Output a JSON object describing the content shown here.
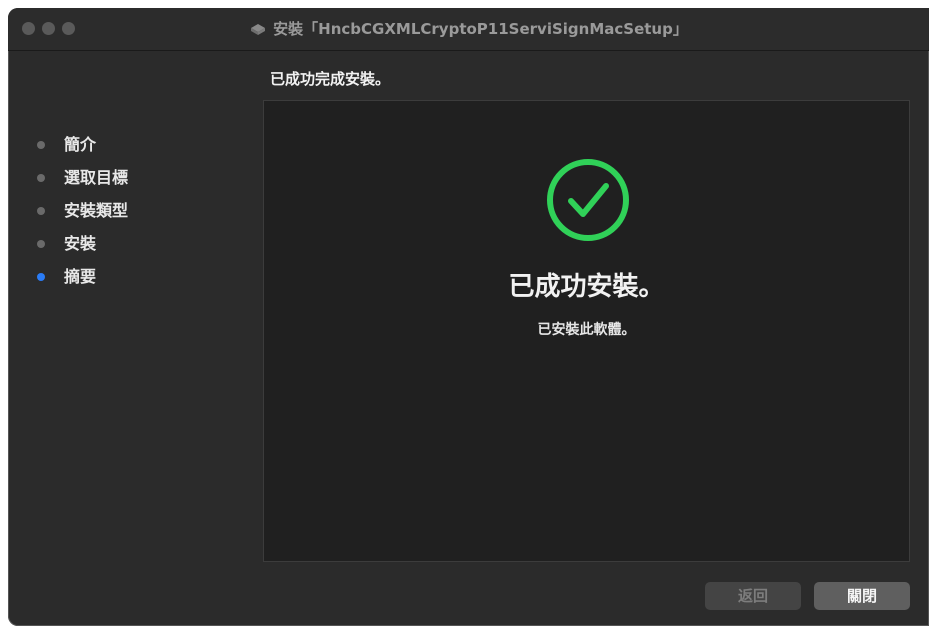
{
  "window": {
    "title": "安裝「HncbCGXMLCryptoP11ServiSignMacSetup」",
    "icon": "installer-package-icon"
  },
  "sidebar": {
    "items": [
      {
        "label": "簡介",
        "active": false
      },
      {
        "label": "選取目標",
        "active": false
      },
      {
        "label": "安裝類型",
        "active": false
      },
      {
        "label": "安裝",
        "active": false
      },
      {
        "label": "摘要",
        "active": true
      }
    ]
  },
  "main": {
    "subtitle": "已成功完成安裝。",
    "success_title": "已成功安裝。",
    "success_message": "已安裝此軟體。",
    "check_icon": "checkmark-circle-icon"
  },
  "buttons": {
    "back": "返回",
    "close": "關閉"
  },
  "colors": {
    "accent_green": "#30d158",
    "active_dot": "#2a7cf6"
  }
}
